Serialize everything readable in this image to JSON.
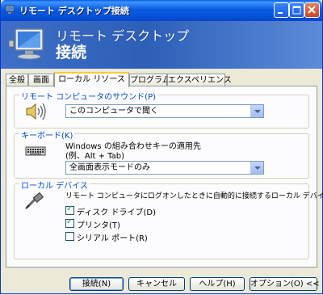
{
  "window": {
    "title": "リモート デスクトップ接続",
    "banner_line1": "リモート デスクトップ",
    "banner_line2": "接続",
    "accent_color": "#0a5ae0"
  },
  "tabs": [
    {
      "label": "全般"
    },
    {
      "label": "画面"
    },
    {
      "label": "ローカル リソース",
      "active": true
    },
    {
      "label": "プログラム"
    },
    {
      "label": "エクスペリエンス"
    }
  ],
  "sound_group": {
    "legend": "リモート コンピュータのサウンド(P)",
    "icon": "speaker-icon",
    "selected": "このコンピュータで聞く"
  },
  "keyboard_group": {
    "legend": "キーボード(K)",
    "icon": "keyboard-icon",
    "description_line1": "Windows の組み合わせキーの適用先",
    "description_line2": "(例、Alt + Tab)",
    "selected": "全画面表示モードのみ"
  },
  "local_devices_group": {
    "legend": "ローカル デバイス",
    "icon": "plug-icon",
    "description": "リモート コンピュータにログオンしたときに自動的に接続するローカル デバイス:",
    "options": [
      {
        "label": "ディスク ドライブ(D)",
        "checked": true
      },
      {
        "label": "プリンタ(T)",
        "checked": true
      },
      {
        "label": "シリアル ポート(R)",
        "checked": false
      }
    ]
  },
  "buttons": {
    "connect": "接続(N)",
    "cancel": "キャンセル",
    "help": "ヘルプ(H)",
    "options": "オプション(O) <<"
  }
}
